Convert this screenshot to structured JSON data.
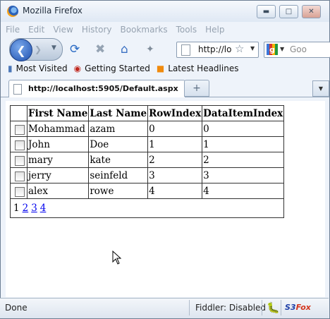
{
  "window": {
    "title": "Mozilla Firefox",
    "minimize_icon": "minimize-icon",
    "maximize_icon": "maximize-icon",
    "close_icon": "close-icon"
  },
  "menu": [
    "File",
    "Edit",
    "View",
    "History",
    "Bookmarks",
    "Tools",
    "Help"
  ],
  "nav": {
    "url": "http://lo",
    "search_placeholder": "Goo"
  },
  "bookmarks": [
    {
      "label": "Most Visited",
      "icon": "bookmark-folder-icon"
    },
    {
      "label": "Getting Started",
      "icon": "firefox-red-icon"
    },
    {
      "label": "Latest Headlines",
      "icon": "rss-icon"
    }
  ],
  "tab": {
    "title": "http://localhost:5905/Default.aspx"
  },
  "grid": {
    "headers": [
      "First Name",
      "Last Name",
      "RowIndex",
      "DataItemIndex"
    ],
    "rows": [
      [
        "Mohammad",
        "azam",
        "0",
        "0"
      ],
      [
        "John",
        "Doe",
        "1",
        "1"
      ],
      [
        "mary",
        "kate",
        "2",
        "2"
      ],
      [
        "jerry",
        "seinfeld",
        "3",
        "3"
      ],
      [
        "alex",
        "rowe",
        "4",
        "4"
      ]
    ],
    "pager": {
      "current": "1",
      "links": [
        "2",
        "3",
        "4"
      ]
    }
  },
  "status": {
    "text": "Done",
    "fiddler": "Fiddler: Disabled",
    "s3": "S3",
    "fox": "Fox"
  }
}
